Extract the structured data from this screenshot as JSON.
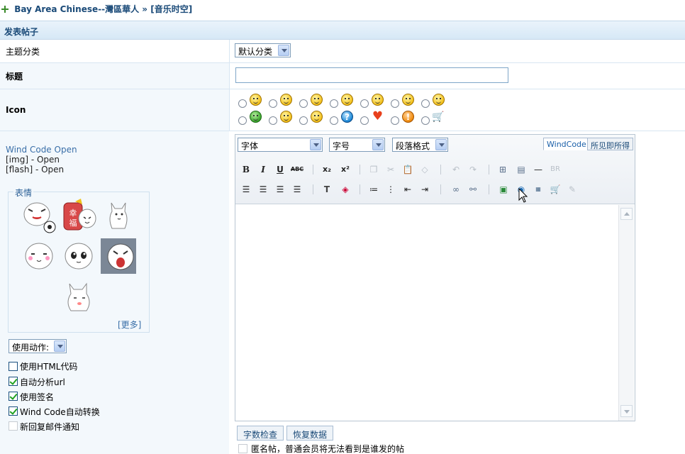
{
  "breadcrumb": {
    "site": "Bay Area Chinese--灣區華人",
    "separator": "»",
    "forum": "[音乐时空]"
  },
  "section_title": "发表帖子",
  "form": {
    "category_label": "主题分类",
    "category_value": "默认分类",
    "title_label": "标题",
    "title_value": "",
    "icon_label": "Icon"
  },
  "wind_code": {
    "title": "Wind Code Open",
    "img_line": "[img] - Open",
    "flash_line": "[flash] - Open"
  },
  "smilies": {
    "legend": "表情",
    "more": "[更多]"
  },
  "action_select": "使用动作:",
  "options": [
    {
      "label": "使用HTML代码",
      "checked": false
    },
    {
      "label": "自动分析url",
      "checked": true
    },
    {
      "label": "使用签名",
      "checked": true
    },
    {
      "label": "Wind Code自动转换",
      "checked": true
    },
    {
      "label": "新回复邮件通知",
      "checked": false
    }
  ],
  "editor": {
    "font_select": "字体",
    "size_select": "字号",
    "format_select": "段落格式",
    "tab_windcode": "WindCode",
    "tab_wysiwyg": "所见即所得",
    "buttons": {
      "bold": "B",
      "italic": "I",
      "underline": "U",
      "strike": "ABC",
      "subscript": "x₂",
      "superscript": "x²",
      "br": "BR"
    }
  },
  "footer": {
    "word_count": "字数检查",
    "restore": "恢复数据",
    "anon_label": "匿名帖，普通会员将无法看到是谁发的帖"
  }
}
